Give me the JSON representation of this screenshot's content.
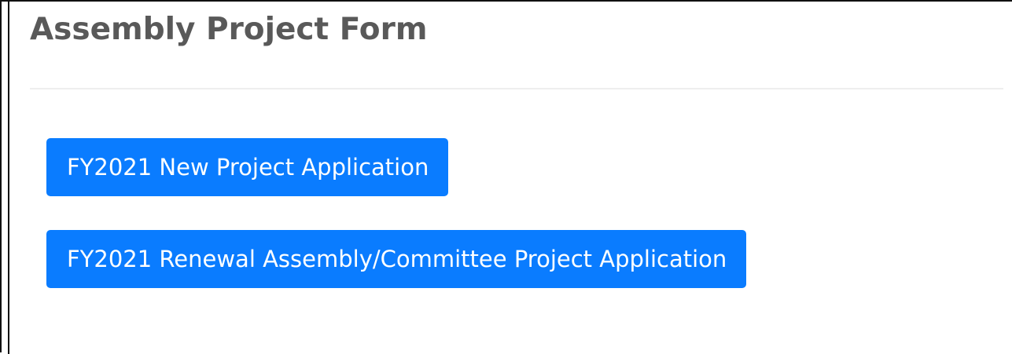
{
  "page": {
    "title": "Assembly Project Form"
  },
  "actions": {
    "new_project_label": "FY2021 New Project Application",
    "renewal_project_label": "FY2021 Renewal Assembly/Committee Project Application"
  },
  "colors": {
    "button_background": "#0a7cff",
    "button_text": "#ffffff",
    "title_text": "#595959",
    "divider": "#eeeeee"
  }
}
